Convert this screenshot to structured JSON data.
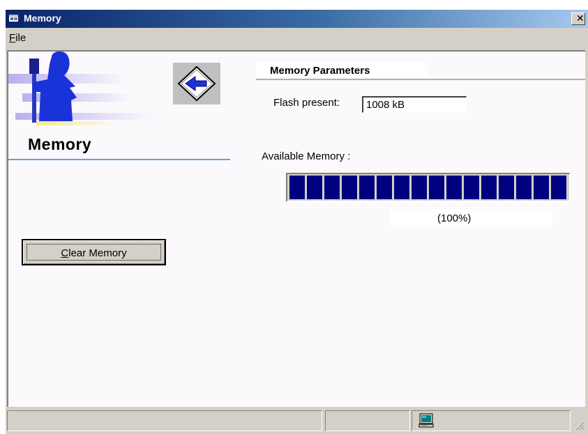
{
  "window": {
    "title": "Memory",
    "close_glyph": "✕",
    "title_icon": "app-window-icon"
  },
  "menu": {
    "file_hotkey": "F",
    "file_rest": "ile"
  },
  "left_panel": {
    "section_title": "Memory",
    "back_icon": "back-arrow-icon",
    "clear_button": {
      "hotkey": "C",
      "rest": "lear Memory"
    }
  },
  "right_panel": {
    "header": "Memory Parameters",
    "flash_label": "Flash present:",
    "flash_value": "1008 kB",
    "available_label": "Available Memory :",
    "available_fraction": 1.0,
    "available_percent_text": "(100%)"
  },
  "statusbar": {
    "icon": "computer-icon"
  },
  "colors": {
    "titlebar_start": "#0a246a",
    "titlebar_end": "#a6caf0",
    "progress_fill": "#000080",
    "client_bg": "#fcf9fc",
    "accent_rule": "#6a9fd8"
  }
}
